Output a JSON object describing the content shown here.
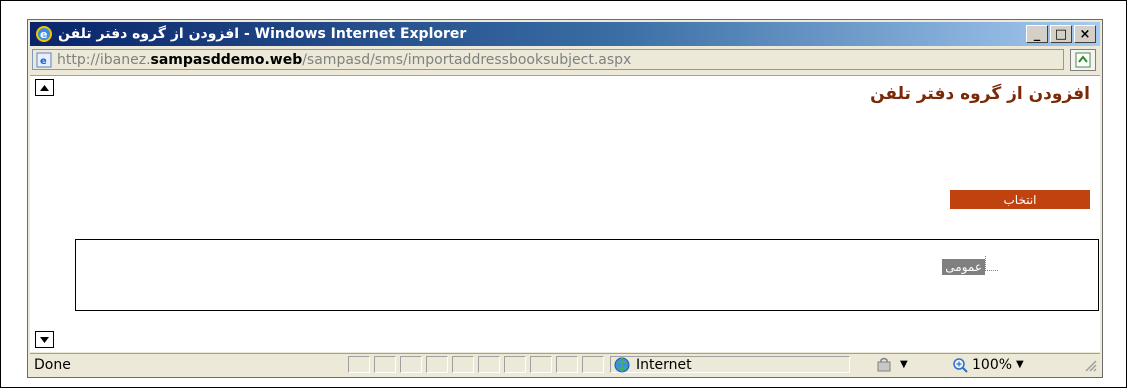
{
  "window": {
    "title": "افزودن از گروه دفتر تلفن - Windows Internet Explorer",
    "minimize_label": "_",
    "maximize_label": "□",
    "close_label": "×"
  },
  "address": {
    "url_prefix": "http://ibanez.",
    "url_host": "sampasddemo.web",
    "url_path": "/sampasd/sms/importaddressbooksubject.aspx"
  },
  "page": {
    "title": "افزودن از گروه دفتر تلفن",
    "select_button_label": "انتخاب",
    "tree_items": [
      "عمومی"
    ]
  },
  "status": {
    "text": "Done",
    "zone": "Internet",
    "zoom": "100%"
  },
  "colors": {
    "titlebar_start": "#0a246a",
    "page_title": "#7a2a07",
    "select_button": "#c0420e"
  },
  "icons": {
    "title": "ie-logo-icon",
    "address": "ie-page-icon",
    "go": "refresh-icon",
    "zone": "globe-icon",
    "protected_mode": "protected-mode-icon",
    "zoom": "zoom-icon"
  }
}
